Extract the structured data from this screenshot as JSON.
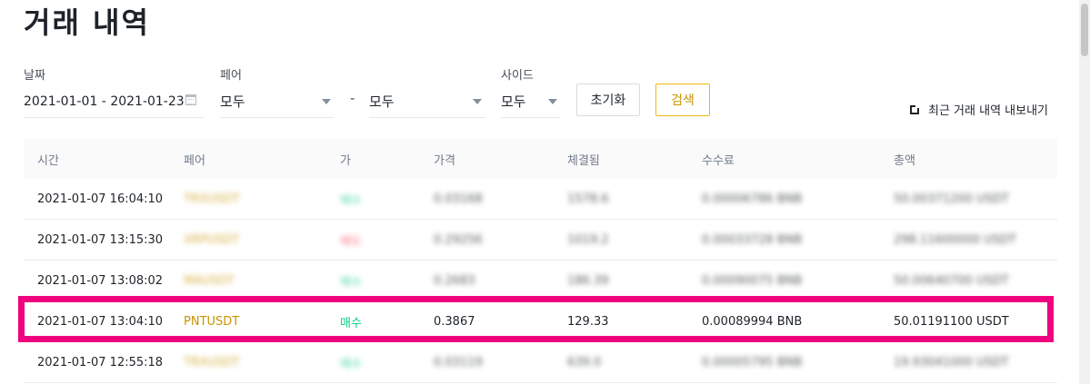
{
  "page": {
    "title": "거래 내역"
  },
  "filters": {
    "date": {
      "label": "날짜",
      "value": "2021-01-01 - 2021-01-23"
    },
    "pair": {
      "label": "페어",
      "base": "모두",
      "quote": "모두",
      "separator": "-"
    },
    "side": {
      "label": "사이드",
      "value": "모두"
    },
    "reset_label": "초기화",
    "search_label": "검색"
  },
  "export": {
    "label": "최근 거래 내역 내보내기",
    "icon": "external-link-icon"
  },
  "table": {
    "headers": [
      "시간",
      "페어",
      "가",
      "가격",
      "체결됨",
      "수수료",
      "총액"
    ],
    "rows": [
      {
        "time": "2021-01-07 16:04:10",
        "pair": "TRXUSDT",
        "side": "매수",
        "price": "0.03168",
        "filled": "1578.6",
        "fee": "0.00006786 BNB",
        "total": "50.00371200 USDT"
      },
      {
        "time": "2021-01-07 13:15:30",
        "pair": "XRPUSDT",
        "side": "매도",
        "price": "0.29256",
        "filled": "1019.2",
        "fee": "0.00033728 BNB",
        "total": "298.11600000 USDT"
      },
      {
        "time": "2021-01-07 13:08:02",
        "pair": "MAUSDT",
        "side": "매수",
        "price": "0.2683",
        "filled": "186.39",
        "fee": "0.00090075 BNB",
        "total": "50.00640700 USDT"
      },
      {
        "time": "2021-01-07 13:04:10",
        "pair": "PNTUSDT",
        "side": "매수",
        "price": "0.3867",
        "filled": "129.33",
        "fee": "0.00089994 BNB",
        "total": "50.01191100 USDT"
      },
      {
        "time": "2021-01-07 12:55:18",
        "pair": "TRXUSDT",
        "side": "매수",
        "price": "0.03119",
        "filled": "639.0",
        "fee": "0.00005795 BNB",
        "total": "19.93041000 USDT"
      }
    ]
  },
  "colors": {
    "accent": "#f0b90b",
    "pair": "#c99400",
    "buy": "#0ecb81",
    "sell": "#f6465d",
    "highlight": "#f0027f"
  }
}
